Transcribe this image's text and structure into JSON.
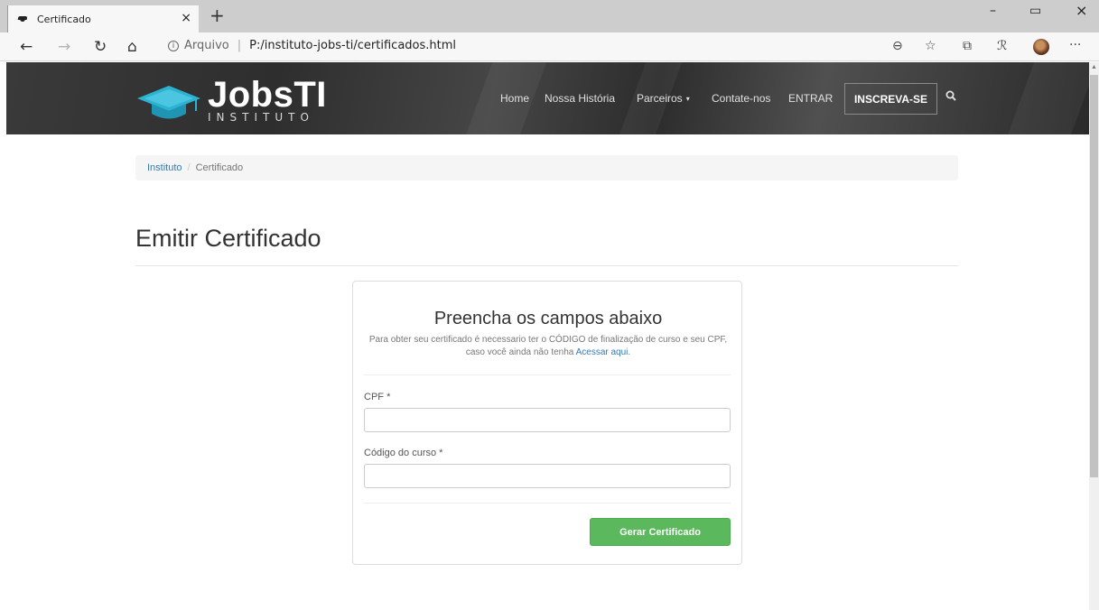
{
  "browser": {
    "tab_title": "Certificado",
    "tab_close": "×",
    "new_tab": "+",
    "window_buttons": {
      "minimize": "–",
      "restore": "▭",
      "close": "×"
    },
    "nav": {
      "back": "←",
      "forward": "→",
      "reload": "↻",
      "home": "⌂"
    },
    "address": {
      "info_glyph": "i",
      "protocol_label": "Arquivo",
      "separator": "|",
      "url": "P:/instituto-jobs-ti/certificados.html"
    },
    "right_icons": {
      "zoom": "⊖",
      "favorite": "☆",
      "collections": "⧉",
      "read_aloud": "ℛ",
      "more": "···"
    }
  },
  "header": {
    "brand": "JobsTI",
    "brand_sub": "INSTITUTO",
    "nav": {
      "home": "Home",
      "history": "Nossa História",
      "partners": "Parceiros",
      "partners_caret": "▾",
      "contact": "Contate-nos",
      "login": "ENTRAR",
      "signup": "INSCREVA-SE"
    }
  },
  "breadcrumb": {
    "root": "Instituto",
    "separator": "/",
    "current": "Certificado"
  },
  "page_title": "Emitir Certificado",
  "form": {
    "heading": "Preencha os campos abaixo",
    "description": "Para obter seu certificado é necessario ter o CÓDIGO de finalização de curso e seu CPF, caso você ainda não tenha",
    "description_link": "Acessar aqui",
    "description_end": ".",
    "cpf_label": "CPF",
    "course_code_label": "Código do curso",
    "required_mark": "*",
    "cpf_value": "",
    "course_code_value": "",
    "submit_label": "Gerar Certificado"
  },
  "colors": {
    "accent_link": "#337ab7",
    "submit_button": "#5cb85c",
    "logo_cap": "#2bb3d2",
    "header_bg": "#333333"
  }
}
